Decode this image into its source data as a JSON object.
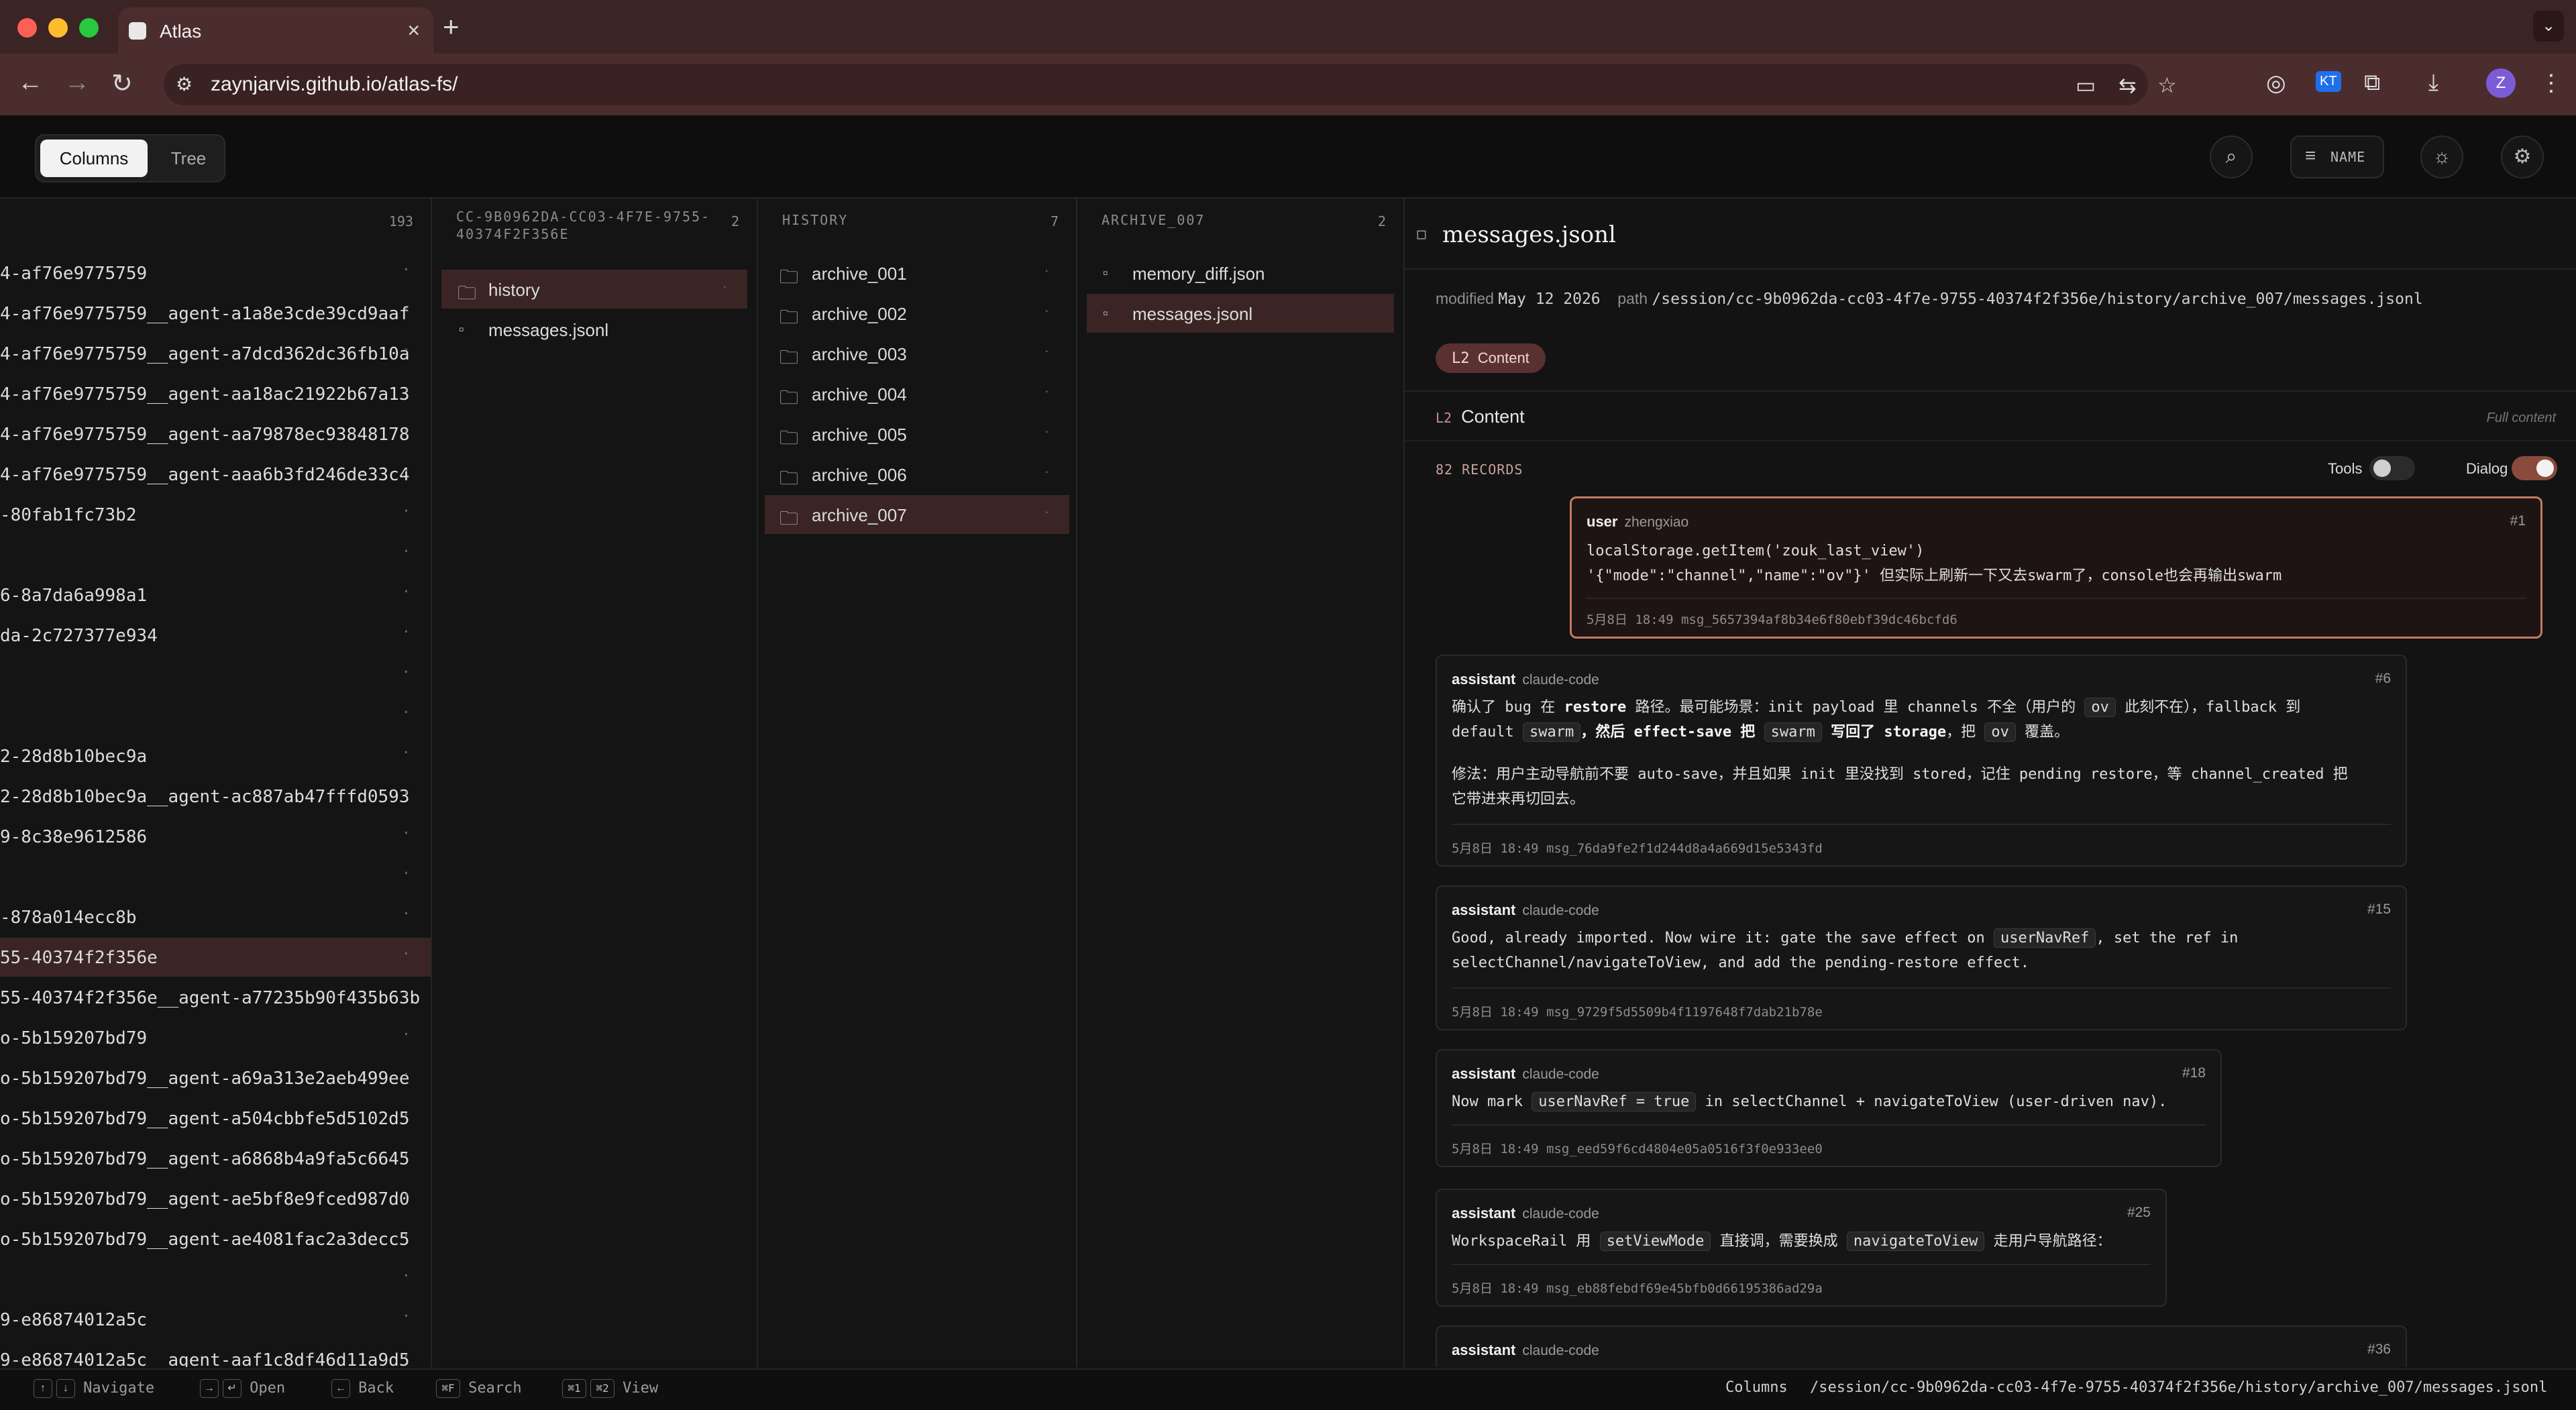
{
  "browser": {
    "tab_title": "Atlas",
    "url": "zaynjarvis.github.io/atlas-fs/",
    "profile_initial": "Z",
    "ext_badge": "KT"
  },
  "header": {
    "view_columns": "Columns",
    "view_tree": "Tree",
    "sort_label": "NAME"
  },
  "col1": {
    "count": "193",
    "items": [
      "4-af76e9775759",
      "4-af76e9775759__agent-a1a8e3cde39cd9aaf",
      "4-af76e9775759__agent-a7dcd362dc36fb10a",
      "4-af76e9775759__agent-aa18ac21922b67a13",
      "4-af76e9775759__agent-aa79878ec93848178",
      "4-af76e9775759__agent-aaa6b3fd246de33c4",
      "-80fab1fc73b2",
      "",
      "6-8a7da6a998a1",
      "da-2c727377e934",
      "",
      "",
      "2-28d8b10bec9a",
      "2-28d8b10bec9a__agent-ac887ab47fffd0593",
      "9-8c38e9612586",
      "",
      "-878a014ecc8b",
      "55-40374f2f356e",
      "55-40374f2f356e__agent-a77235b90f435b63b",
      "o-5b159207bd79",
      "o-5b159207bd79__agent-a69a313e2aeb499ee",
      "o-5b159207bd79__agent-a504cbbfe5d5102d5",
      "o-5b159207bd79__agent-a6868b4a9fa5c6645",
      "o-5b159207bd79__agent-ae5bf8e9fced987d0",
      "o-5b159207bd79__agent-ae4081fac2a3decc5",
      "",
      "9-e86874012a5c",
      "9-e86874012a5c__agent-aaf1c8df46d11a9d5"
    ]
  },
  "col2": {
    "title": "CC-9B0962DA-CC03-4F7E-9755-40374F2F356E",
    "count": "2",
    "items": [
      "history",
      "messages.jsonl"
    ]
  },
  "col3": {
    "title": "HISTORY",
    "count": "7",
    "items": [
      "archive_001",
      "archive_002",
      "archive_003",
      "archive_004",
      "archive_005",
      "archive_006",
      "archive_007"
    ]
  },
  "col4": {
    "title": "ARCHIVE_007",
    "count": "2",
    "items": [
      "memory_diff.json",
      "messages.jsonl"
    ]
  },
  "detail": {
    "title": "messages.jsonl",
    "modified_label": "modified",
    "modified_value": "May 12 2026",
    "path_label": "path",
    "path_value": "/session/cc-9b0962da-cc03-4f7e-9755-40374f2f356e/history/archive_007/messages.jsonl",
    "pill_level": "L2",
    "pill_label": "Content",
    "section_level": "L2",
    "section_label": "Content",
    "section_hint": "Full content",
    "records": "82 RECORDS",
    "tools_label": "Tools",
    "dialog_label": "Dialog"
  },
  "messages": [
    {
      "role": "user",
      "who": "zhengxiao",
      "num": "#1",
      "line1": "localStorage.getItem('zouk_last_view')",
      "line2": "'{\"mode\":\"channel\",\"name\":\"ov\"}' 但实际上刷新一下又去swarm了，console也会再输出swarm",
      "foot": "5月8日 18:49  msg_5657394af8b34e6f80ebf39dc46bcfd6"
    },
    {
      "role": "assistant",
      "who": "claude-code",
      "num": "#6",
      "p1a": "确认了 bug 在 ",
      "p1b": "restore",
      "p1c": " 路径。最可能场景：init payload 里 channels 不全（用户的 ",
      "p1d": "ov",
      "p1e": " 此刻不在），fallback 到",
      "p2a": "default ",
      "p2b": "swarm",
      "p2c": "，然后 ",
      "p2d": "effect-save",
      "p2e": " 把 ",
      "p2f": "swarm",
      "p2g": " 写回了 ",
      "p2h": "storage",
      "p2i": "，把 ",
      "p2j": "ov",
      "p2k": " 覆盖。",
      "p3": "修法：用户主动导航前不要 auto-save，并且如果 init 里没找到 stored，记住 pending restore，等 channel_created 把",
      "p4": "它带进来再切回去。",
      "foot": "5月8日 18:49  msg_76da9fe2f1d244d8a4a669d15e5343fd"
    },
    {
      "role": "assistant",
      "who": "claude-code",
      "num": "#15",
      "l1a": "Good, already imported. Now wire it: gate the save effect on ",
      "l1b": "userNavRef",
      "l1c": ", set the ref in",
      "l2": "selectChannel/navigateToView, and add the pending-restore effect.",
      "foot": "5月8日 18:49  msg_9729f5d5509b4f1197648f7dab21b78e"
    },
    {
      "role": "assistant",
      "who": "claude-code",
      "num": "#18",
      "l1a": "Now mark ",
      "l1b": "userNavRef = true",
      "l1c": " in selectChannel + navigateToView (user-driven nav).",
      "foot": "5月8日 18:49  msg_eed59f6cd4804e05a0516f3f0e933ee0"
    },
    {
      "role": "assistant",
      "who": "claude-code",
      "num": "#25",
      "l1a": "WorkspaceRail 用 ",
      "l1b": "setViewMode",
      "l1c": " 直接调，需要换成 ",
      "l1d": "navigateToView",
      "l1e": " 走用户导航路径：",
      "foot": "5月8日 18:49  msg_eb88febdf69e45bfb0d66195386ad29a"
    },
    {
      "role": "assistant",
      "who": "claude-code",
      "num": "#36"
    }
  ],
  "status": {
    "navigate": "Navigate",
    "open": "Open",
    "back": "Back",
    "search_key": "⌘F",
    "search": "Search",
    "view_k1": "⌘1",
    "view_k2": "⌘2",
    "view": "View",
    "mode": "Columns",
    "path": "/session/cc-9b0962da-cc03-4f7e-9755-40374f2f356e/history/archive_007/messages.jsonl"
  }
}
